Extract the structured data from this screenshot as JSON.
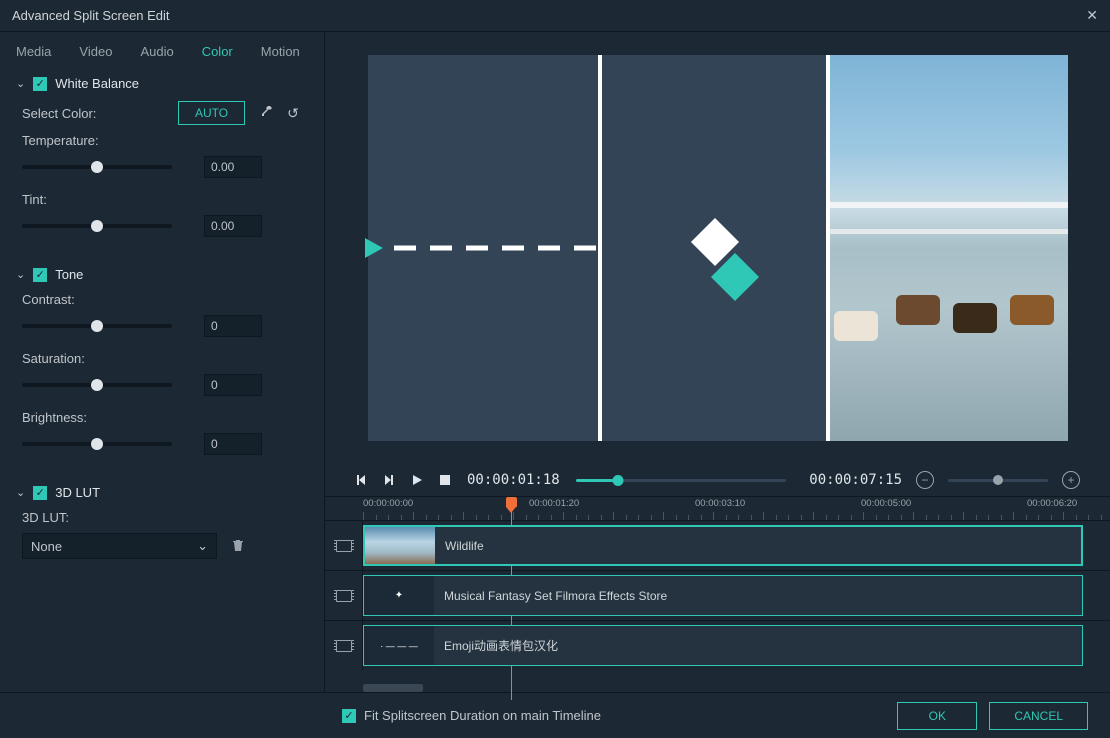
{
  "title": "Advanced Split Screen Edit",
  "tabs": [
    "Media",
    "Video",
    "Audio",
    "Color",
    "Motion"
  ],
  "active_tab": "Color",
  "white_balance": {
    "title": "White Balance",
    "select_color_label": "Select Color:",
    "auto": "AUTO",
    "temperature_label": "Temperature:",
    "temperature_value": "0.00",
    "tint_label": "Tint:",
    "tint_value": "0.00"
  },
  "tone": {
    "title": "Tone",
    "contrast_label": "Contrast:",
    "contrast_value": "0",
    "saturation_label": "Saturation:",
    "saturation_value": "0",
    "brightness_label": "Brightness:",
    "brightness_value": "0"
  },
  "lut": {
    "title": "3D LUT",
    "label": "3D LUT:",
    "value": "None"
  },
  "transport": {
    "current": "00:00:01:18",
    "total": "00:00:07:15"
  },
  "ruler": [
    "00:00:00:00",
    "00:00:01:20",
    "00:00:03:10",
    "00:00:05:00",
    "00:00:06:20"
  ],
  "tracks": [
    {
      "label": "Wildlife"
    },
    {
      "label": "Musical Fantasy Set Filmora Effects Store"
    },
    {
      "label": "Emoji动画表情包汉化"
    }
  ],
  "footer": {
    "fit_label": "Fit Splitscreen Duration on main Timeline",
    "ok": "OK",
    "cancel": "CANCEL"
  }
}
